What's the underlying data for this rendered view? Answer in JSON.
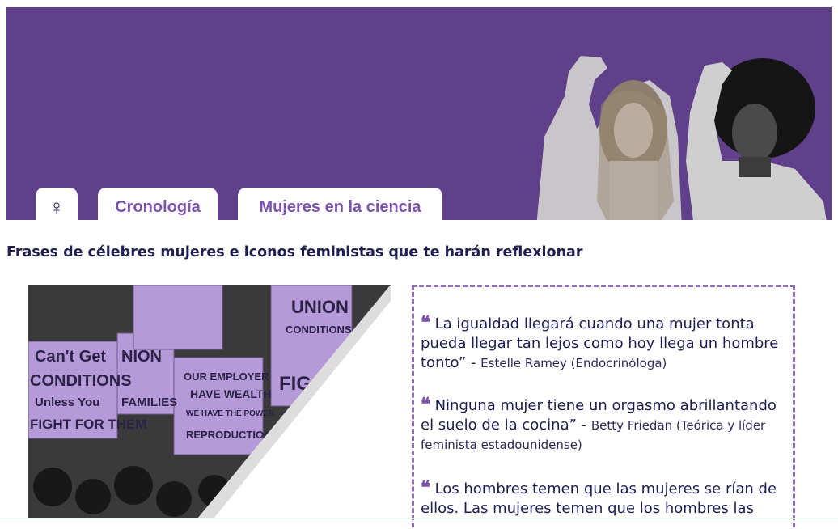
{
  "tabs": {
    "home_icon": "♀",
    "cronologia": "Cronología",
    "ciencia": "Mujeres en la ciencia"
  },
  "heading": "Frases de célebres mujeres e iconos feministas que te harán reflexionar",
  "photo_signs": [
    "Can't Get",
    "CONDITIONS",
    "Unless You",
    "FIGHT FOR THEM",
    "NION",
    "FAMILIES",
    "UNION",
    "CONDITIONS",
    "OUR EMPLOYER",
    "HAVE WEALTH",
    "WE HAVE THE POWER",
    "REPRODUCTION",
    "FIG"
  ],
  "quotes": [
    {
      "text": "La igualdad llegará cuando una mujer tonta pueda llegar tan lejos como hoy llega un hombre tonto” - ",
      "author": "Estelle Ramey (Endocrinóloga)"
    },
    {
      "text": "Ninguna mujer tiene un orgasmo abrillantando el suelo de la cocina” - ",
      "author": "Betty Friedan (Teórica y líder feminista estadounidense)"
    },
    {
      "text": "Los hombres temen que las mujeres se rían de ellos. Las mujeres temen que los hombres las",
      "author": ""
    }
  ],
  "colors": {
    "banner": "#603f8b",
    "accent": "#7c52b0",
    "text": "#211f50",
    "photo_tint": "#b49ad8"
  }
}
